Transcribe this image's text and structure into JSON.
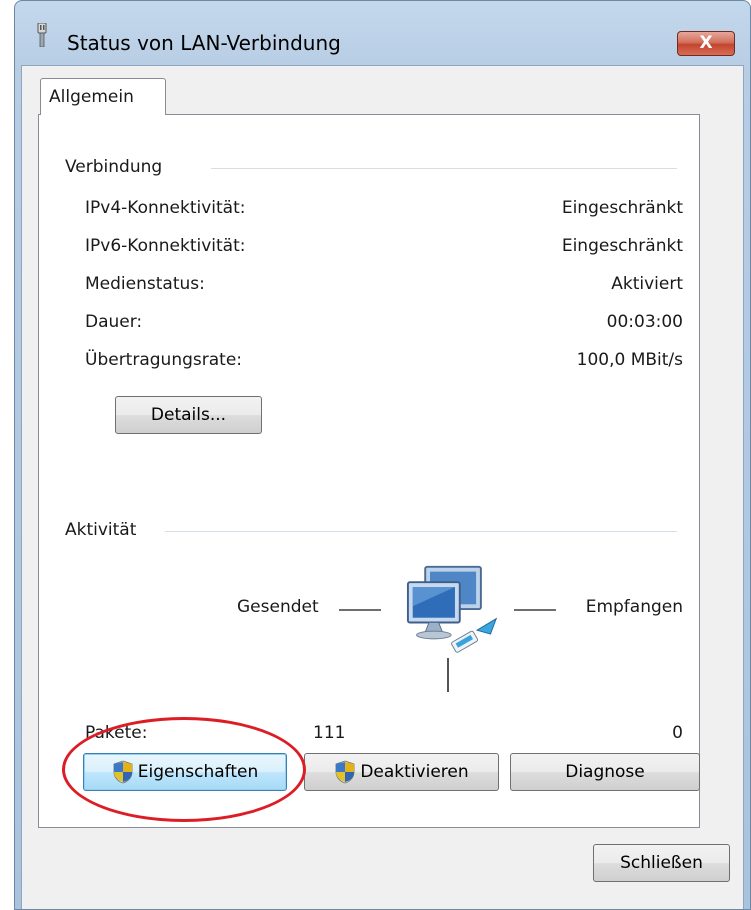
{
  "window": {
    "title": "Status von LAN-Verbindung",
    "close_label": "X"
  },
  "tabs": [
    {
      "label": "Allgemein",
      "selected": true
    }
  ],
  "connection": {
    "heading": "Verbindung",
    "rows": [
      {
        "label": "IPv4-Konnektivität:",
        "value": "Eingeschränkt"
      },
      {
        "label": "IPv6-Konnektivität:",
        "value": "Eingeschränkt"
      },
      {
        "label": "Medienstatus:",
        "value": "Aktiviert"
      },
      {
        "label": "Dauer:",
        "value": "00:03:00"
      },
      {
        "label": "Übertragungsrate:",
        "value": "100,0 MBit/s"
      }
    ],
    "details_button": "Details..."
  },
  "activity": {
    "heading": "Aktivität",
    "sent_label": "Gesendet",
    "received_label": "Empfangen",
    "packets_label": "Pakete:",
    "packets_sent": "111",
    "packets_received": "0"
  },
  "buttons": {
    "properties": "Eigenschaften",
    "deactivate": "Deaktivieren",
    "diagnose": "Diagnose",
    "close": "Schließen"
  },
  "icons": {
    "title": "network-plug-icon",
    "network": "network-computers-icon",
    "shield": "uac-shield-icon"
  },
  "colors": {
    "highlight": "#dc1d25",
    "close_button": "#c3452f",
    "frame": "#b7cde4"
  }
}
